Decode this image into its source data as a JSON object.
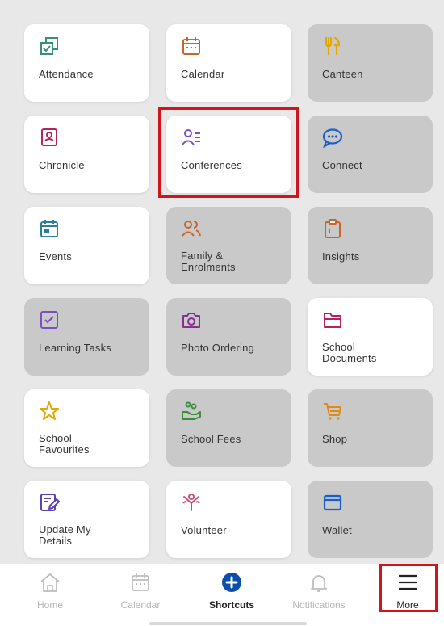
{
  "shortcuts": [
    {
      "label": "Attendance",
      "icon": "attendance-icon",
      "color": "#3a8f7a",
      "enabled": true
    },
    {
      "label": "Calendar",
      "icon": "calendar-icon",
      "color": "#c9642a",
      "enabled": true
    },
    {
      "label": "Canteen",
      "icon": "cutlery-icon",
      "color": "#e0a800",
      "enabled": false
    },
    {
      "label": "Chronicle",
      "icon": "chronicle-icon",
      "color": "#b3245f",
      "enabled": true
    },
    {
      "label": "Conferences",
      "icon": "conferences-icon",
      "color": "#7a4fc2",
      "enabled": true
    },
    {
      "label": "Connect",
      "icon": "chat-bubble-icon",
      "color": "#1b5fc7",
      "enabled": false
    },
    {
      "label": "Events",
      "icon": "events-icon",
      "color": "#2a7f9a",
      "enabled": true
    },
    {
      "label": "Family &\nEnrolments",
      "icon": "family-icon",
      "color": "#c9642a",
      "enabled": false
    },
    {
      "label": "Insights",
      "icon": "clipboard-icon",
      "color": "#c9642a",
      "enabled": false
    },
    {
      "label": "Learning Tasks",
      "icon": "checkbox-icon",
      "color": "#7a4fc2",
      "enabled": false
    },
    {
      "label": "Photo Ordering",
      "icon": "camera-icon",
      "color": "#8a2d8f",
      "enabled": false
    },
    {
      "label": "School\nDocuments",
      "icon": "folder-icon",
      "color": "#b3245f",
      "enabled": true
    },
    {
      "label": "School\nFavourites",
      "icon": "star-icon",
      "color": "#e0a800",
      "enabled": true
    },
    {
      "label": "School Fees",
      "icon": "payment-hand-icon",
      "color": "#3a8f3a",
      "enabled": false
    },
    {
      "label": "Shop",
      "icon": "cart-icon",
      "color": "#e08a1a",
      "enabled": false
    },
    {
      "label": "Update My\nDetails",
      "icon": "edit-profile-icon",
      "color": "#5a3fb5",
      "enabled": true
    },
    {
      "label": "Volunteer",
      "icon": "volunteer-icon",
      "color": "#d04a7a",
      "enabled": true
    },
    {
      "label": "Wallet",
      "icon": "wallet-icon",
      "color": "#1b5fc7",
      "enabled": false
    }
  ],
  "nav": {
    "home": "Home",
    "calendar": "Calendar",
    "shortcuts": "Shortcuts",
    "notifications": "Notifications",
    "more": "More"
  },
  "colors": {
    "accent": "#0b4fa8",
    "highlight": "#d0161c",
    "tile_enabled": "#ffffff",
    "tile_disabled": "#c9c9c9"
  }
}
